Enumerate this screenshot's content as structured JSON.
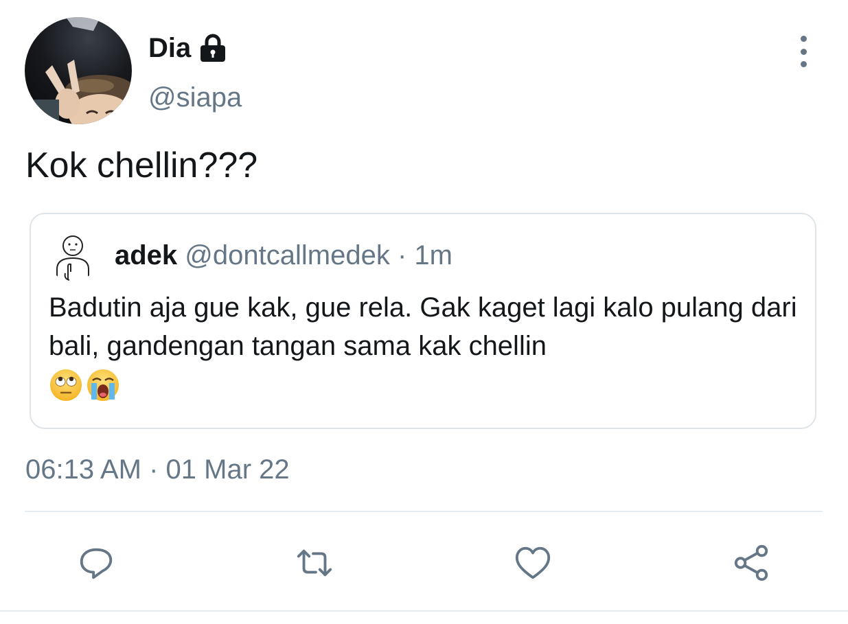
{
  "author": {
    "display_name": "Dia",
    "handle": "@siapa",
    "protected_icon": "lock-icon"
  },
  "tweet": {
    "text": "Kok chellin???",
    "timestamp": "06:13 AM · 01 Mar 22"
  },
  "quoted_tweet": {
    "display_name": "adek",
    "handle_and_time": "@dontcallmedek · 1m",
    "text": "Badutin aja gue kak, gue rela. Gak kaget lagi kalo pulang dari bali, gandengan tangan sama kak chellin",
    "emojis": [
      "face-with-rolling-eyes-emoji",
      "loudly-crying-face-emoji"
    ]
  },
  "actions": [
    "reply-icon",
    "retweet-icon",
    "like-icon",
    "share-icon"
  ],
  "colors": {
    "primary_text": "#14171a",
    "secondary_text": "#657786",
    "border": "#dfe4e8",
    "divider": "#e6ecf0"
  }
}
